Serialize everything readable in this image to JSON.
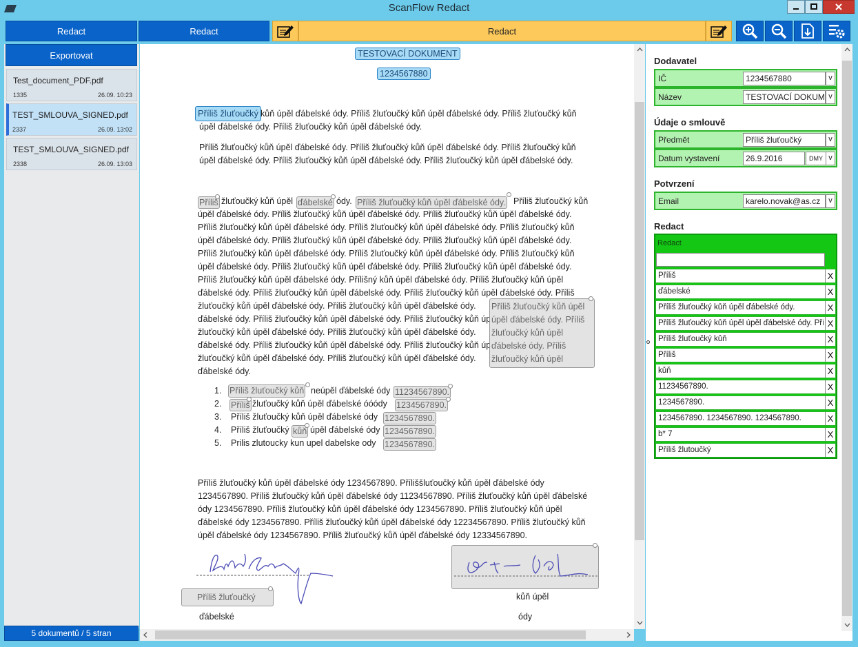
{
  "window": {
    "title": "ScanFlow Redact"
  },
  "toolbar": {
    "redact_btn_1": "Redact",
    "redact_btn_2": "Redact",
    "redact_bar": "Redact"
  },
  "sidebar": {
    "export_label": "Exportovat",
    "documents": [
      {
        "name": "Test_document_PDF.pdf",
        "pages": "1335",
        "date": "26.09.  10:23"
      },
      {
        "name": "TEST_SMLOUVA_SIGNED.pdf",
        "pages": "2337",
        "date": "26.09.  13:02"
      },
      {
        "name": "TEST_SMLOUVA_SIGNED.pdf",
        "pages": "2338",
        "date": "26.09.  13:03"
      }
    ],
    "count_label": "5 dokumentů / 5 stran"
  },
  "document": {
    "title": "TESTOVACÍ DOKUMENT",
    "number": "1234567880",
    "p1_hl": "Příliš žluťoučký",
    "p1_l1": "kůň úpěl ďábelské ódy. Příliš žluťoučký kůň úpěl ďábelské ódy. Příliš žluťoučký kůň",
    "p1_l2": "úpěl ďábelské ódy. Příliš žluťoučký kůň úpěl ďábelské ódy.",
    "p2_l1": "Příliš žluťoučký kůň úpěl ďábelské ódy. Příliš žluťoučký kůň úpěl ďábelské ódy. Příliš žluťoučký kůň",
    "p2_l2": "úpěl ďábelské ódy. Příliš žluťoučký kůň úpěl ďábelské ódy. Příliš žluťoučký kůň úpěl ďábelské ódy.",
    "p3_hl_a": "Příliš",
    "p3_t1": "žluťoučký kůň úpěl",
    "p3_hl_b": "ďábelské",
    "p3_t2": "ódy.",
    "p3_hl_c": "Příliš žluťoučký kůň úpěl ďábelské ódy.",
    "p3_t3": "Příliš žluťoučký kůň",
    "p3_lines": [
      "úpěl ďábelské ódy. Příliš žluťoučký kůň úpěl ďábelské ódy. Příliš žluťoučký kůň úpěl ďábelské ódy.",
      "Příliš žluťoučký kůň úpěl ďábelské ódy. Příliš žluťoučký kůň úpěl ďábelské ódy. Příliš žluťoučký kůň",
      "úpěl ďábelské ódy. Příliš žluťoučký kůň úpěl ďábelské ódy. Příliš žluťoučký kůň úpěl ďábelské ódy.",
      "Příliš žluťoučký kůň úpěl ďábelské ódy. Příliš žluťoučký kůň úpěl ďábelské ódy. Příliš žluťoučký kůň",
      "úpěl ďábelské ódy. Příliš žluťoučký kůň úpěl ďábelské ódy. Příliš žluťoučký kůň úpěl ďábelské ódy.",
      "Příliš žluťoučký kůň úpěl ďábelské ódy. Přílišný kůň úpěl ďábelské ódy. Příliš žluťoučký kůň úpěl",
      "ďábelské ódy. Příliš žluťoučký kůň úpěl ďábelské ódy. Příliš žluťoučký kůň úpěl ďábelské ódy. Příliš",
      "žluťoučký kůň úpěl ďábelské ódy. Příliš žluťoučký kůň úpěl ďábelské ódy.",
      "ďábelské ódy. Příliš žluťoučký kůň úpěl ďábelské ódy. Příliš žluťoučký kůň úpěl ďábelské ódy.",
      "žluťoučký kůň úpěl ďábelské ódy. Příliš žluťoučký kůň úpěl ďábelské ódy.",
      "ďábelské ódy. Příliš žluťoučký kůň úpěl ďábelské ódy. Příliš žluťoučký kůň úpěl ďábelské ódy.",
      "žluťoučký kůň úpěl ďábelské ódy. Příliš žluťoučký kůň úpěl ďábelské ódy.",
      "ďábelské ódy."
    ],
    "p3_block": [
      "Příliš žluťoučký kůň úpěl",
      "úpěl ďábelské ódy. Příliš",
      "žluťoučký kůň úpěl",
      "ďábelské ódy. Příliš",
      "žluťoučký kůň úpěl"
    ],
    "list": [
      {
        "num": "1.",
        "hl": "Příliš žluťoučký kůň",
        "t": "neúpěl ďábelské ódy",
        "hl2": "11234567890."
      },
      {
        "num": "2.",
        "hl": "Příliš",
        "t": "žluťoučký kůň úpěl ďábelské óóódy",
        "hl2": "1234567890."
      },
      {
        "num": "3.",
        "t": "Příliš žluťoučký kůň úpěl ďábelské ódy",
        "hl2": "1234567890."
      },
      {
        "num": "4.",
        "t": "Příliš žluťoučký",
        "hl": "kůň",
        "t2": "úpěl ďábelské ódy",
        "hl2": "1234567890."
      },
      {
        "num": "5.",
        "t": "Prilis zlutoucky kun upel dabelske ody",
        "hl2": "1234567890."
      }
    ],
    "p4": [
      "Příliš žluťoučký kůň úpěl ďábelské ódy 1234567890. Příliššluťoučký kůň úpěl ďábelské  ódy",
      "1234567890. Příliš žluťoučký kůň úpěl ďábelské ódy 11234567890. Příliš žluťoučký kůň úpěl ďábelské",
      "ódy 1234567890. Příliš žluťoučký kůň úpěl ďábelské ódy 1234567890. Příliš žluťoučký kůň úpěl",
      "ďábelské ódy 1234567890. Příliš žluťoučký kůň úpěl ďábelské ódy 12234567890. Příliš žluťoučký kůň",
      "úpěl ďábelské ódy 1234567890. Příliš žluťoučký kůň úpěl ďábelské ódy 12334567890."
    ],
    "sig_left_hl": "Příliš žluťoučký",
    "sig_left_text": "ďábelské",
    "sig_right_text_1": "kůň úpěl",
    "sig_right_text_2": "ódy"
  },
  "fields": {
    "sections": {
      "supplier": "Dodavatel",
      "contract": "Údaje o smlouvě",
      "confirm": "Potvrzení",
      "redact": "Redact"
    },
    "ic": {
      "label": "IČ",
      "value": "1234567880"
    },
    "name": {
      "label": "Název",
      "value": "TESTOVACÍ DOKUMENT"
    },
    "subject": {
      "label": "Předmět",
      "value": "Příliš žluťoučký"
    },
    "date": {
      "label": "Datum vystavení",
      "value": "26.9.2016",
      "fmt": "DMY"
    },
    "email": {
      "label": "Email",
      "value": "karelo.novak@as.cz"
    },
    "dropdown_glyph": "v"
  },
  "redact_panel": {
    "label": "Redact",
    "input_value": "",
    "remove_glyph": "X",
    "items": [
      "Příliš",
      "ďábelské",
      "Příliš žluťoučký kůň úpěl ďábelské ódy.",
      "Příliš žluťoučký kůň úpěl úpěl ďábelské ódy. Příliš",
      "Příliš žluťoučký kůň",
      "Příliš",
      "kůň",
      "11234567890.",
      "1234567890.",
      "1234567890. 1234567890. 1234567890.",
      "b* 7",
      "Příliš žlutoučký"
    ]
  },
  "colors": {
    "accent_blue": "#0a63c9",
    "redact_yellow": "#fdc95b",
    "field_green": "#b3f3b1",
    "redact_green": "#14c714",
    "titlebar": "#6ccbea"
  }
}
